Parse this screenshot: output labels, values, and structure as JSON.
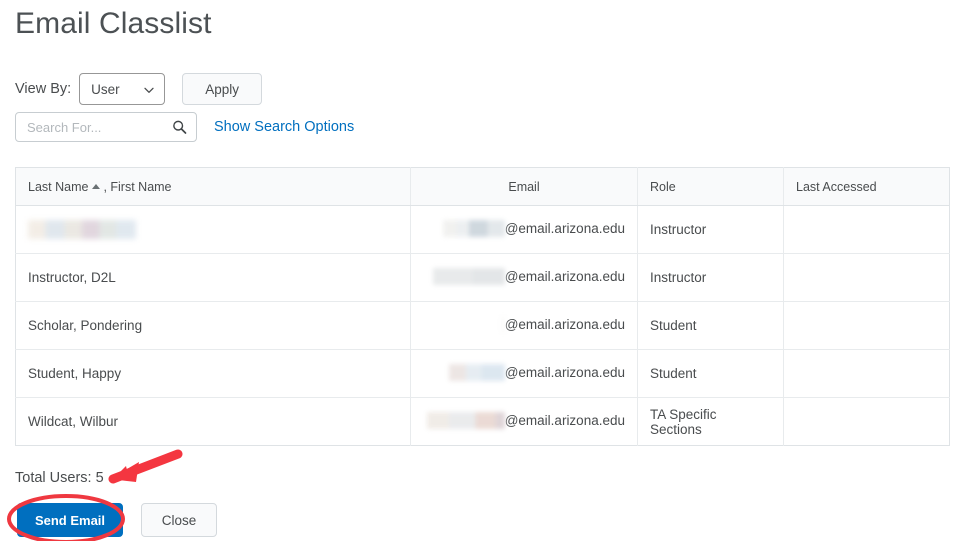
{
  "header": {
    "title": "Email Classlist"
  },
  "toolbar": {
    "view_by_label": "View By:",
    "view_by_value": "User",
    "view_by_icon": "chevron-down-icon",
    "apply_label": "Apply",
    "search_placeholder": "Search For...",
    "search_value": "",
    "search_icon": "search-icon",
    "show_search_options_label": "Show Search Options"
  },
  "table": {
    "columns": [
      {
        "label": "Last Name",
        "sort": "ascending",
        "label_suffix": ", First Name"
      },
      {
        "label": "Email"
      },
      {
        "label": "Role"
      },
      {
        "label": "Last Accessed"
      }
    ],
    "rows": [
      {
        "name": "",
        "name_redacted": true,
        "email_redacted": true,
        "email_domain": "@email.arizona.edu",
        "role": "Instructor",
        "last_accessed": ""
      },
      {
        "name": "Instructor, D2L",
        "name_redacted": false,
        "email_redacted": true,
        "email_domain": "@email.arizona.edu",
        "role": "Instructor",
        "last_accessed": ""
      },
      {
        "name": "Scholar, Pondering",
        "name_redacted": false,
        "email_redacted": true,
        "email_domain": "@email.arizona.edu",
        "role": "Student",
        "last_accessed": ""
      },
      {
        "name": "Student, Happy",
        "name_redacted": false,
        "email_redacted": true,
        "email_domain": "@email.arizona.edu",
        "role": "Student",
        "last_accessed": ""
      },
      {
        "name": "Wildcat, Wilbur",
        "name_redacted": false,
        "email_redacted": true,
        "email_domain": "@email.arizona.edu",
        "role": "TA Specific Sections",
        "last_accessed": ""
      }
    ]
  },
  "footer": {
    "total_users_label": "Total Users: 5",
    "send_email_label": "Send Email",
    "close_label": "Close"
  },
  "annotations": {
    "arrow": {
      "name": "red-arrow-annotation",
      "color": "#f43640",
      "points_to": "Total Users: 5"
    },
    "ellipse": {
      "name": "red-ellipse-annotation",
      "color": "#ef3840",
      "encircles": "Send Email"
    }
  },
  "colors": {
    "accent_blue": "#006fbf",
    "link_blue": "#006fbf",
    "annotation_red": "#f43640",
    "text": "#494c4e",
    "table_border": "#dfe3e6",
    "header_bg": "#f9fafb"
  }
}
